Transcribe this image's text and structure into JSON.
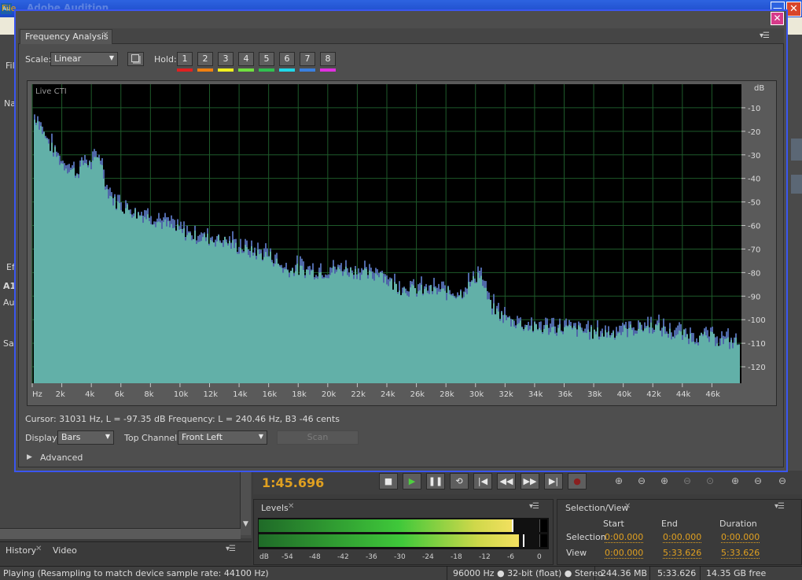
{
  "app": {
    "icon_text": "Au",
    "title": "Adobe Audition",
    "minimize_glyph": "—",
    "close_glyph": "✕",
    "menu_file": "File"
  },
  "left_panel": {
    "fragments": [
      "Fil",
      "Na",
      "Ef",
      "A1",
      "Au",
      "Sa"
    ]
  },
  "history_panel": {
    "tabs": [
      {
        "label": "History"
      },
      {
        "label": "Video"
      }
    ]
  },
  "transport": {
    "time": "1:45.696",
    "buttons": [
      "stop-icon",
      "play-icon",
      "pause-icon",
      "loop-icon",
      "go-to-start-icon",
      "rewind-icon",
      "fast-forward-icon",
      "go-to-end-icon",
      "record-icon"
    ],
    "zoom_buttons": [
      "zoom-in-amplitude-icon",
      "zoom-out-amplitude-icon",
      "zoom-in-time-icon",
      "zoom-out-time-icon",
      "zoom-selection-icon",
      "zoom-in-left-icon",
      "zoom-in-right-icon",
      "zoom-out-full-icon"
    ]
  },
  "levels": {
    "tab_label": "Levels",
    "scale_labels": [
      "dB",
      "-54",
      "-48",
      "-42",
      "-36",
      "-30",
      "-24",
      "-18",
      "-12",
      "-6",
      "0"
    ],
    "left_level": 0.88,
    "right_level": 0.9
  },
  "selection_view": {
    "tab_label": "Selection/View",
    "headers": [
      "Start",
      "End",
      "Duration"
    ],
    "rows": [
      {
        "label": "Selection",
        "start": "0:00.000",
        "end": "0:00.000",
        "duration": "0:00.000"
      },
      {
        "label": "View",
        "start": "0:00.000",
        "end": "5:33.626",
        "duration": "5:33.626"
      }
    ]
  },
  "status": {
    "message": "Playing (Resampling to match device sample rate: 44100 Hz)",
    "format": "96000 Hz ● 32-bit (float) ● Stereo",
    "size": "244.36 MB",
    "duration": "5:33.626",
    "free": "14.35 GB free"
  },
  "frequency_analysis": {
    "tab_label": "Frequency Analysis",
    "scale_label": "Scale:",
    "scale_value": "Linear",
    "hold_label": "Hold:",
    "hold_buttons": [
      "1",
      "2",
      "3",
      "4",
      "5",
      "6",
      "7",
      "8"
    ],
    "hold_colors": [
      "#e02020",
      "#f08010",
      "#f0f020",
      "#70e040",
      "#30c050",
      "#20d8e8",
      "#3a80e0",
      "#e030e0"
    ],
    "cursor_info": "Cursor: 31031 Hz, L = -97.35 dB  Frequency: L = 240.46 Hz, B3 -46 cents",
    "display_label": "Display:",
    "display_value": "Bars",
    "top_channel_label": "Top Channel:",
    "top_channel_value": "Front Left",
    "scan_label": "Scan",
    "advanced_label": "Advanced"
  },
  "chart_data": {
    "type": "bar",
    "title": "",
    "overlay_label": "Live CTI",
    "xlabel": "",
    "ylabel": "dB",
    "x_unit_label": "Hz",
    "x_tick_labels": [
      "Hz",
      "2k",
      "4k",
      "6k",
      "8k",
      "10k",
      "12k",
      "14k",
      "16k",
      "18k",
      "20k",
      "22k",
      "24k",
      "26k",
      "28k",
      "30k",
      "32k",
      "34k",
      "36k",
      "38k",
      "40k",
      "42k",
      "44k",
      "46k"
    ],
    "x_ticks_hz": [
      0,
      2000,
      4000,
      6000,
      8000,
      10000,
      12000,
      14000,
      16000,
      18000,
      20000,
      22000,
      24000,
      26000,
      28000,
      30000,
      32000,
      34000,
      36000,
      38000,
      40000,
      42000,
      44000,
      46000
    ],
    "y_tick_labels": [
      "dB",
      "-10",
      "-20",
      "-30",
      "-40",
      "-50",
      "-60",
      "-70",
      "-80",
      "-90",
      "-100",
      "-110",
      "-120"
    ],
    "y_ticks_db": [
      -10,
      -20,
      -30,
      -40,
      -50,
      -60,
      -70,
      -80,
      -90,
      -100,
      -110,
      -120
    ],
    "xlim": [
      0,
      48000
    ],
    "ylim": [
      -127,
      0
    ],
    "grid": true,
    "background": "#000000",
    "grid_color": "#1e5a2a",
    "fill_color": "#62b0a8",
    "peak_color": "#4f68a8",
    "series": [
      {
        "values_hz": [
          300,
          1000,
          2000,
          3000,
          3500,
          4000,
          4500,
          5000,
          5500,
          6000,
          7000,
          8000,
          9000,
          10000,
          11000,
          12000,
          13000,
          14000,
          15000,
          16000,
          17000,
          18000,
          19000,
          20000,
          21000,
          22000,
          23000,
          23500,
          24000,
          25000,
          26000,
          27000,
          28000,
          29000,
          29800,
          30200,
          30600,
          31000,
          32000,
          33000,
          34000,
          35000,
          36000,
          37000,
          38000,
          39000,
          40000,
          41000,
          42000,
          43000,
          44000,
          45000,
          46000,
          47000,
          48000
        ],
        "values_db": [
          -15,
          -25,
          -34,
          -38,
          -33,
          -35,
          -30,
          -45,
          -50,
          -52,
          -55,
          -57,
          -60,
          -63,
          -65,
          -66,
          -67,
          -70,
          -72,
          -73,
          -79,
          -79,
          -80,
          -80,
          -79,
          -80,
          -82,
          -79,
          -84,
          -87,
          -88,
          -88,
          -89,
          -89,
          -84,
          -80,
          -88,
          -95,
          -100,
          -102,
          -104,
          -104,
          -104,
          -105,
          -106,
          -106,
          -105,
          -104,
          -103,
          -106,
          -107,
          -108,
          -108,
          -110,
          -110
        ]
      }
    ]
  }
}
